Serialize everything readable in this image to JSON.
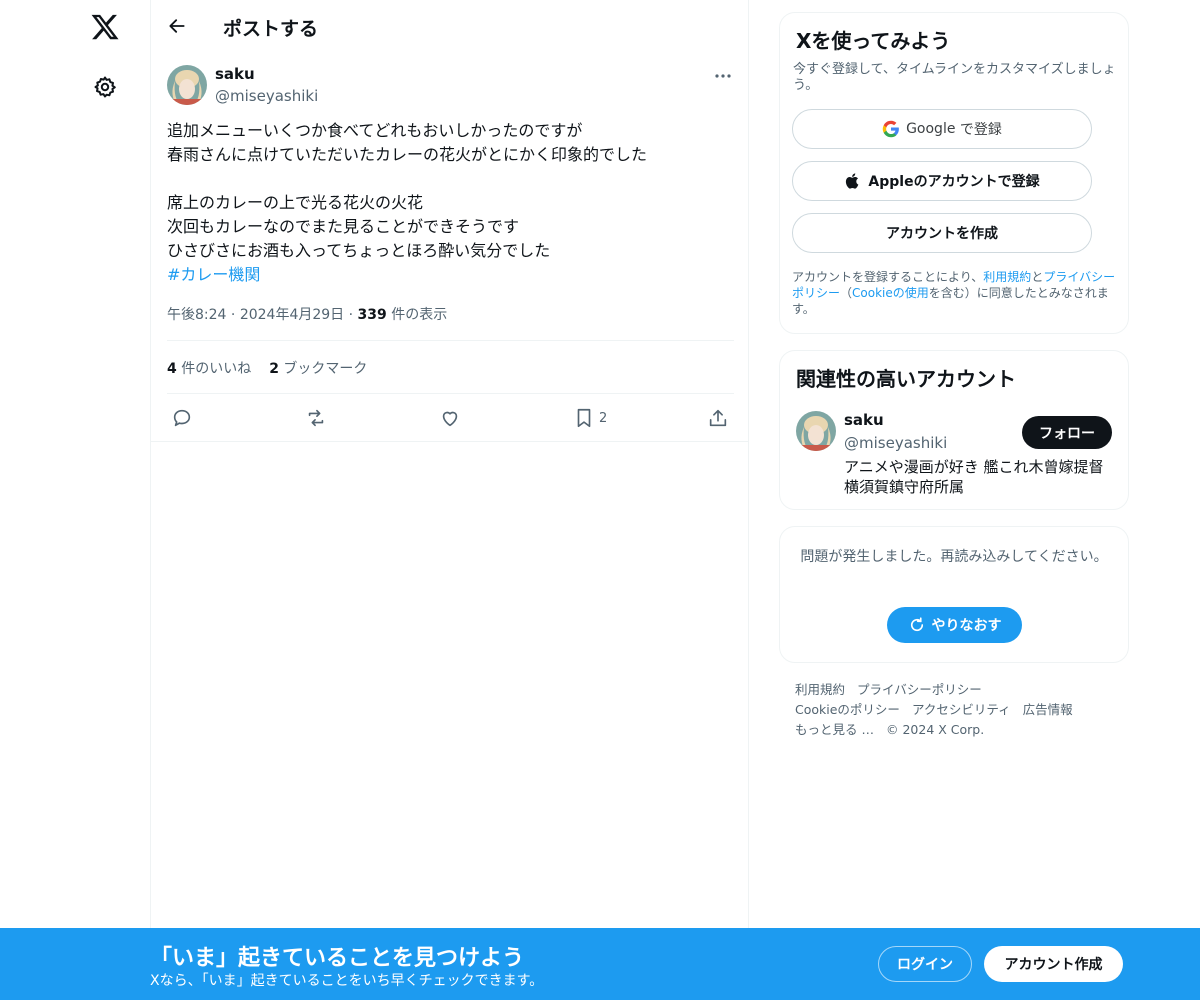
{
  "colors": {
    "accent": "#1d9bf0",
    "text": "#0f1419",
    "muted": "#536471",
    "border": "#eff3f4"
  },
  "nav": {
    "logo_icon": "x-logo-icon",
    "settings_icon": "gear-icon"
  },
  "header": {
    "title": "ポストする"
  },
  "tweet": {
    "author_name": "saku",
    "author_handle": "@miseyashiki",
    "lines": [
      "追加メニューいくつか食べてどれもおいしかったのですが",
      "春雨さんに点けていただいたカレーの花火がとにかく印象的でした",
      "",
      "席上のカレーの上で光る花火の火花",
      "次回もカレーなのでまた見ることができそうです",
      "ひさびさにお酒も入ってちょっとほろ酔い気分でした"
    ],
    "hashtag": "#カレー機関",
    "time": "午後8:24",
    "date": "2024年4月29日",
    "views_count": "339",
    "views_label": "件の表示",
    "likes_count": "4",
    "likes_label": "件のいいね",
    "bookmarks_count": "2",
    "bookmarks_label": "ブックマーク",
    "bookmark_action_count": "2"
  },
  "signup": {
    "title": "Xを使ってみよう",
    "subtitle": "今すぐ登録して、タイムラインをカスタマイズしましょう。",
    "google_label": "Google",
    "google_suffix": "で登録",
    "apple_label": "Appleのアカウントで登録",
    "create_label": "アカウントを作成",
    "legal_pre": "アカウントを登録することにより、",
    "legal_terms": "利用規約",
    "legal_and": "と",
    "legal_privacy": "プライバシーポリシー",
    "legal_open": "（",
    "legal_cookie": "Cookieの使用",
    "legal_post": "を含む）に同意したとみなされます。"
  },
  "related": {
    "title": "関連性の高いアカウント",
    "name": "saku",
    "handle": "@miseyashiki",
    "follow_label": "フォロー",
    "bio": "アニメや漫画が好き 艦これ木曾嫁提督 横須賀鎮守府所属"
  },
  "error": {
    "message": "問題が発生しました。再読み込みしてください。",
    "retry_label": "やりなおす"
  },
  "footer": {
    "links": [
      "利用規約",
      "プライバシーポリシー",
      "Cookieのポリシー",
      "アクセシビリティ",
      "広告情報",
      "もっと見る …"
    ],
    "copyright": "© 2024 X Corp."
  },
  "banner": {
    "title": "「いま」起きていることを見つけよう",
    "subtitle": "Xなら、「いま」起きていることをいち早くチェックできます。",
    "login_label": "ログイン",
    "create_label": "アカウント作成"
  }
}
